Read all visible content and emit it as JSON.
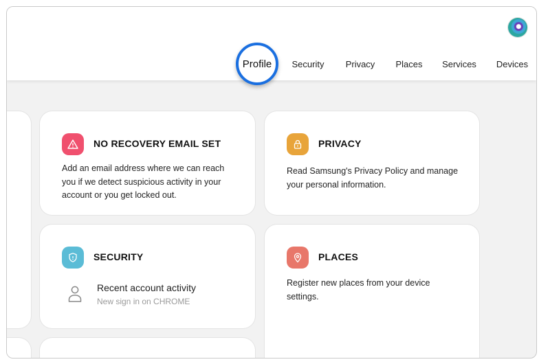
{
  "nav": {
    "items": [
      "Profile",
      "Security",
      "Privacy",
      "Places",
      "Services",
      "Devices"
    ],
    "active": "Profile"
  },
  "cards": {
    "recovery": {
      "title": "NO RECOVERY EMAIL SET",
      "text_lines": [
        "Add an email address where we can reach",
        "you if we detect suspicious activity in your",
        "account or you get locked out."
      ],
      "icon": "warning-icon",
      "color": "#f0506e"
    },
    "privacy": {
      "title": "PRIVACY",
      "text_lines": [
        "Read Samsung's Privacy Policy and manage",
        "your personal information."
      ],
      "icon": "lock-icon",
      "color": "#e8a43a"
    },
    "security": {
      "title": "SECURITY",
      "activity_title": "Recent account activity",
      "activity_sub": "New sign in on CHROME",
      "icon": "shield-icon",
      "color": "#5bbcd6"
    },
    "places": {
      "title": "PLACES",
      "text_lines": [
        "Register new places from your device",
        "settings."
      ],
      "icon": "location-pin-icon",
      "color": "#e8776a"
    }
  },
  "colors": {
    "accent_ring": "#1a6fe0",
    "background": "#f2f2f2"
  }
}
